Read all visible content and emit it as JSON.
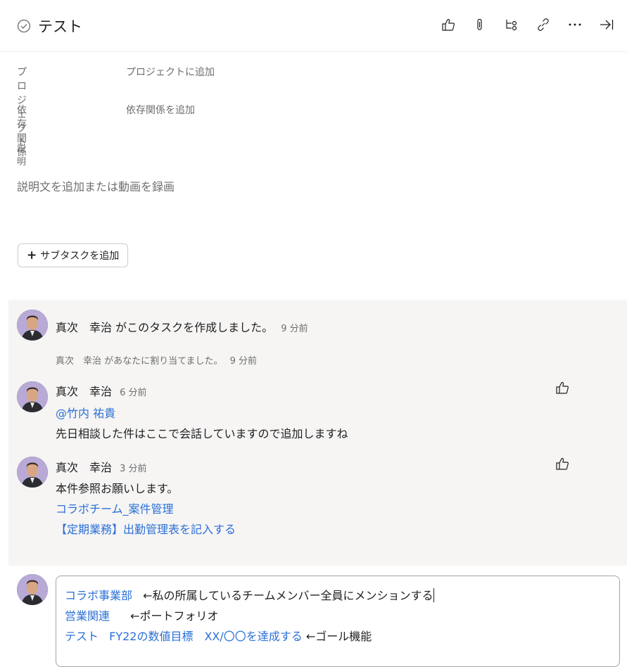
{
  "header": {
    "title": "テスト",
    "icons": [
      "check-circle-icon",
      "like-icon",
      "attachment-icon",
      "subtasks-icon",
      "link-icon",
      "more-icon",
      "close-panel-icon"
    ]
  },
  "fields": {
    "project_label": "プロジェクト",
    "project_value": "プロジェクトに追加",
    "dependency_label": "依存関係",
    "dependency_value": "依存関係を追加",
    "description_label": "説明"
  },
  "description_placeholder": "説明文を追加または動画を録画",
  "subtask_button": {
    "plus": "+",
    "label": "サブタスクを追加"
  },
  "activity": {
    "created": {
      "name": "真次　幸治",
      "text": "がこのタスクを作成しました。",
      "time": "9 分前"
    },
    "assigned": {
      "text": "真次　幸治 があなたに割り当てました。",
      "time": "9 分前"
    },
    "comments": [
      {
        "name": "真次　幸治",
        "time": "6 分前",
        "mention": "@竹内 祐貴",
        "text": "先日相談した件はここで会話していますので追加しますね"
      },
      {
        "name": "真次　幸治",
        "time": "3 分前",
        "text": "本件参照お願いします。",
        "link1": "コラボチーム_案件管理",
        "link2": "【定期業務】出勤管理表を記入する"
      }
    ]
  },
  "composer": {
    "line1_link": "コラボ事業部",
    "line1_text": "←私の所属しているチームメンバー全員にメンションする",
    "line2_link": "営業関連",
    "line2_text": "←ポートフォリオ",
    "line3_link1": "テスト",
    "line3_link2": "FY22の数値目標　XX/〇〇を達成する",
    "line3_text": "←ゴール機能"
  },
  "colors": {
    "link": "#2b6fd6",
    "text": "#1e1f21",
    "muted": "#6d6e6f",
    "activity_bg": "#f6f5f4"
  }
}
